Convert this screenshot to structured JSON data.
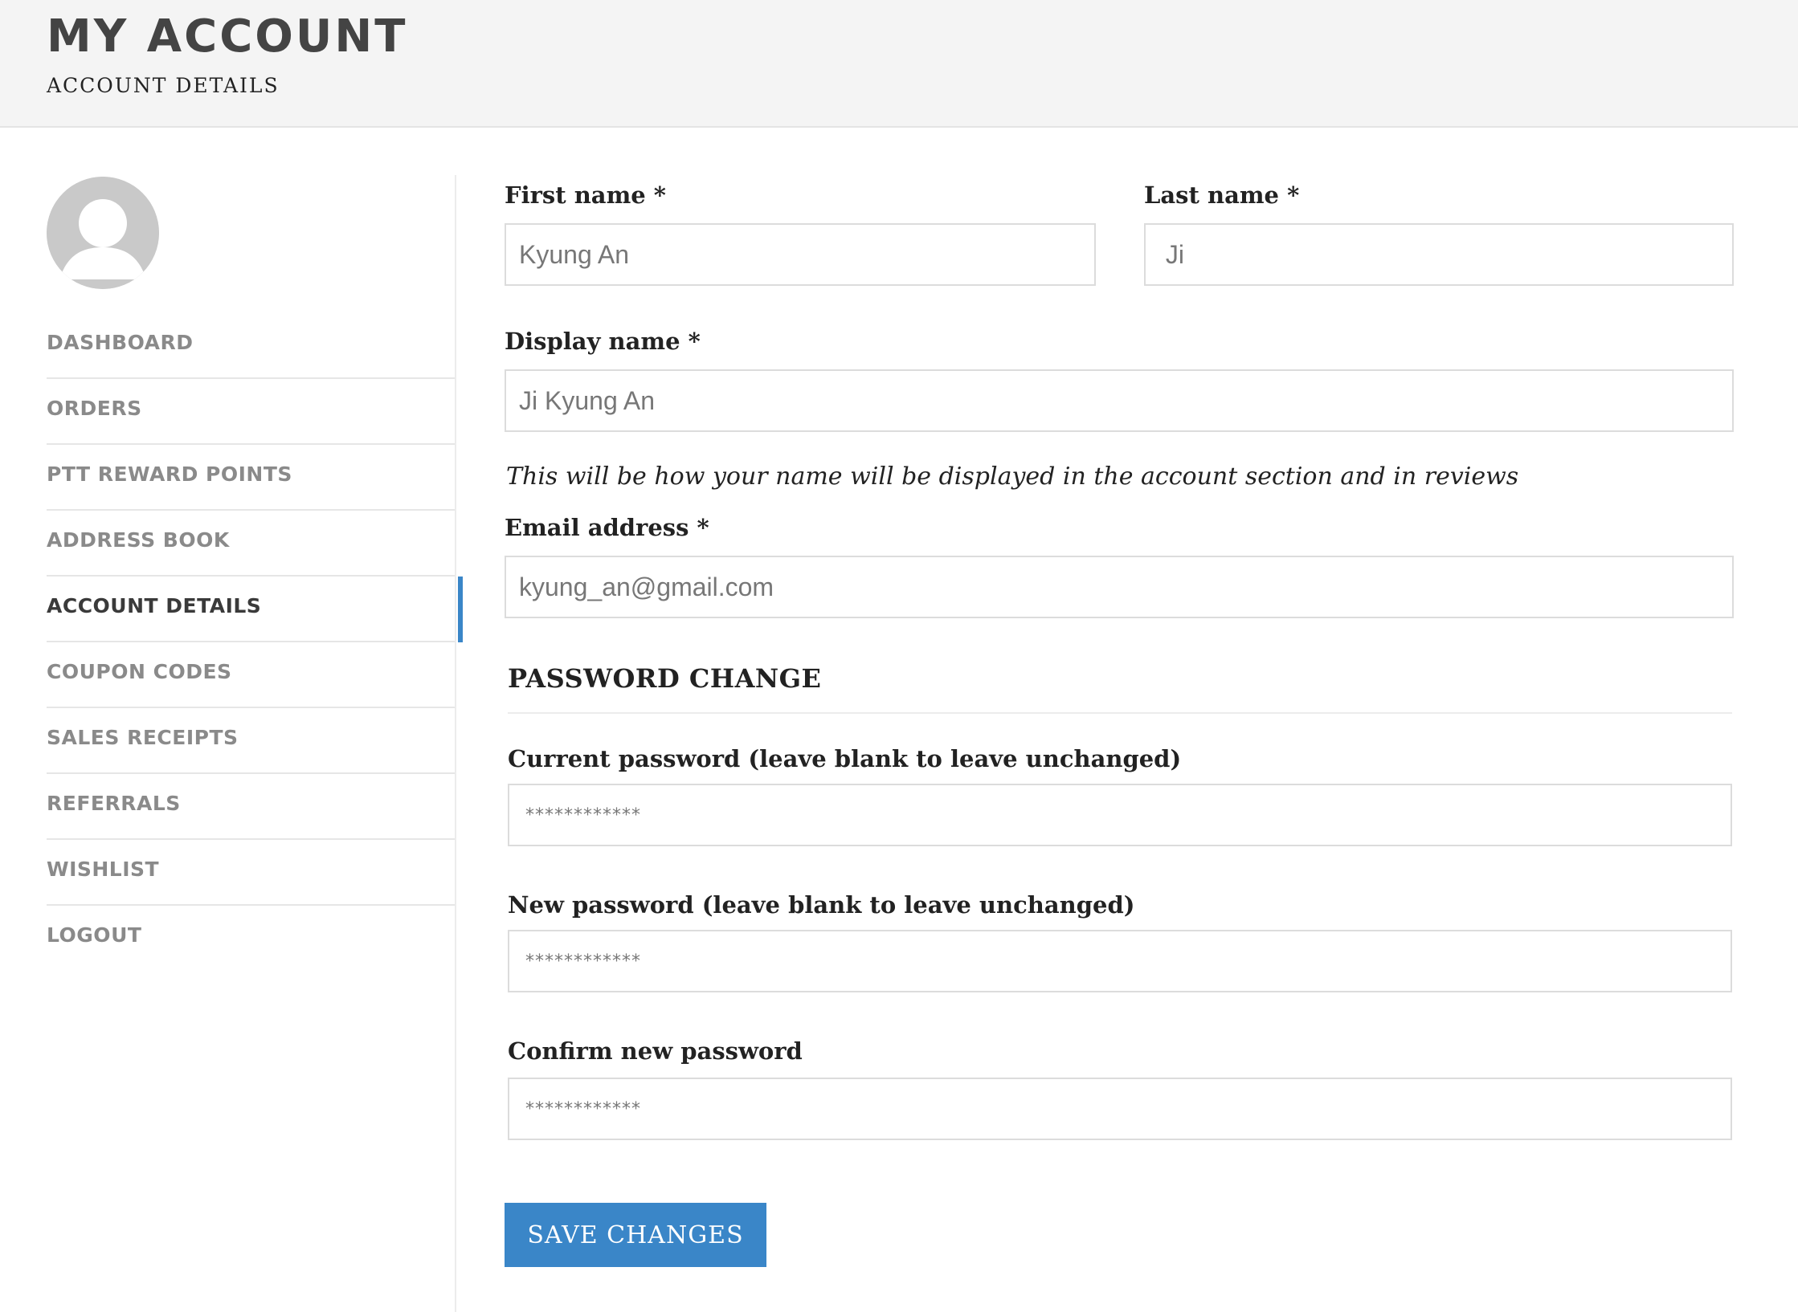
{
  "header": {
    "title": "MY ACCOUNT",
    "subtitle": "ACCOUNT DETAILS"
  },
  "sidebar": {
    "avatar_icon": "user-silhouette-icon",
    "items": [
      {
        "label": "DASHBOARD",
        "active": false
      },
      {
        "label": "ORDERS",
        "active": false
      },
      {
        "label": "PTT REWARD POINTS",
        "active": false
      },
      {
        "label": "ADDRESS BOOK",
        "active": false
      },
      {
        "label": "ACCOUNT DETAILS",
        "active": true
      },
      {
        "label": "COUPON CODES",
        "active": false
      },
      {
        "label": "SALES RECEIPTS",
        "active": false
      },
      {
        "label": "REFERRALS",
        "active": false
      },
      {
        "label": "WISHLIST",
        "active": false
      },
      {
        "label": "LOGOUT",
        "active": false
      }
    ],
    "active_color": "#3a86c8"
  },
  "form": {
    "first_name": {
      "label": "First name *",
      "value": "Kyung An"
    },
    "last_name": {
      "label": "Last name *",
      "value": " Ji"
    },
    "display_name": {
      "label": "Display name *",
      "value": "Ji Kyung An",
      "help": "This will be how your name will be displayed in the account section and in reviews"
    },
    "email": {
      "label": "Email address *",
      "value": "kyung_an@gmail.com"
    },
    "password_section": {
      "title": "PASSWORD CHANGE",
      "current": {
        "label": "Current password (leave blank to leave unchanged)",
        "value": "************"
      },
      "new": {
        "label": "New password (leave blank to leave unchanged)",
        "value": "************"
      },
      "confirm": {
        "label": "Confirm new password",
        "value": "************"
      }
    },
    "save_label": "SAVE CHANGES",
    "button_color": "#3a86c8"
  }
}
